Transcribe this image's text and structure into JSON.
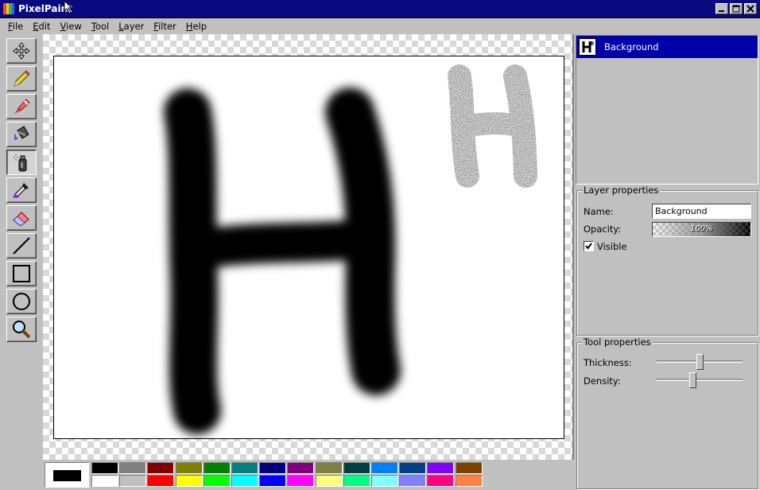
{
  "window": {
    "title": "PixelPaint"
  },
  "menu": [
    {
      "label": "File",
      "u": "F",
      "rest": "ile"
    },
    {
      "label": "Edit",
      "u": "E",
      "rest": "dit"
    },
    {
      "label": "View",
      "u": "V",
      "rest": "iew"
    },
    {
      "label": "Tool",
      "u": "T",
      "rest": "ool"
    },
    {
      "label": "Layer",
      "u": "L",
      "rest": "ayer"
    },
    {
      "label": "Filter",
      "u": "F",
      "rest": "ilter"
    },
    {
      "label": "Help",
      "u": "H",
      "rest": "elp"
    }
  ],
  "tools": [
    {
      "name": "move-tool",
      "icon": "move-icon",
      "active": false
    },
    {
      "name": "pencil-tool",
      "icon": "pencil-icon",
      "active": false
    },
    {
      "name": "brush-tool",
      "icon": "brush-icon",
      "active": false
    },
    {
      "name": "fill-tool",
      "icon": "bucket-icon",
      "active": false
    },
    {
      "name": "airbrush-tool",
      "icon": "spray-can-icon",
      "active": true
    },
    {
      "name": "color-picker-tool",
      "icon": "eyedropper-icon",
      "active": false
    },
    {
      "name": "eraser-tool",
      "icon": "eraser-icon",
      "active": false
    },
    {
      "name": "line-tool",
      "icon": "line-icon",
      "active": false
    },
    {
      "name": "rectangle-tool",
      "icon": "rectangle-icon",
      "active": false
    },
    {
      "name": "ellipse-tool",
      "icon": "ellipse-icon",
      "active": false
    },
    {
      "name": "zoom-tool",
      "icon": "magnifier-icon",
      "active": false
    }
  ],
  "palette": {
    "current_color": "#000000",
    "top_row": [
      "#000000",
      "#808080",
      "#800000",
      "#808000",
      "#008000",
      "#008080",
      "#000080",
      "#800080",
      "#808040",
      "#004040",
      "#0080ff",
      "#004080",
      "#8000ff",
      "#804000"
    ],
    "bottom_row": [
      "#ffffff",
      "#c0c0c0",
      "#ff0000",
      "#ffff00",
      "#00ff00",
      "#00ffff",
      "#0000ff",
      "#ff00ff",
      "#ffff80",
      "#00ff80",
      "#80ffff",
      "#8080ff",
      "#ff0080",
      "#ff8040"
    ]
  },
  "layers": {
    "items": [
      {
        "name": "Background",
        "selected": true
      }
    ]
  },
  "layer_properties": {
    "title": "Layer properties",
    "name_label": "Name:",
    "name_value": "Background",
    "opacity_label": "Opacity:",
    "opacity_value": "100%",
    "visible_label": "Visible",
    "visible_checked": true
  },
  "tool_properties": {
    "title": "Tool properties",
    "thickness_label": "Thickness:",
    "thickness_level": 0.46,
    "density_label": "Density:",
    "density_level": 0.38
  }
}
